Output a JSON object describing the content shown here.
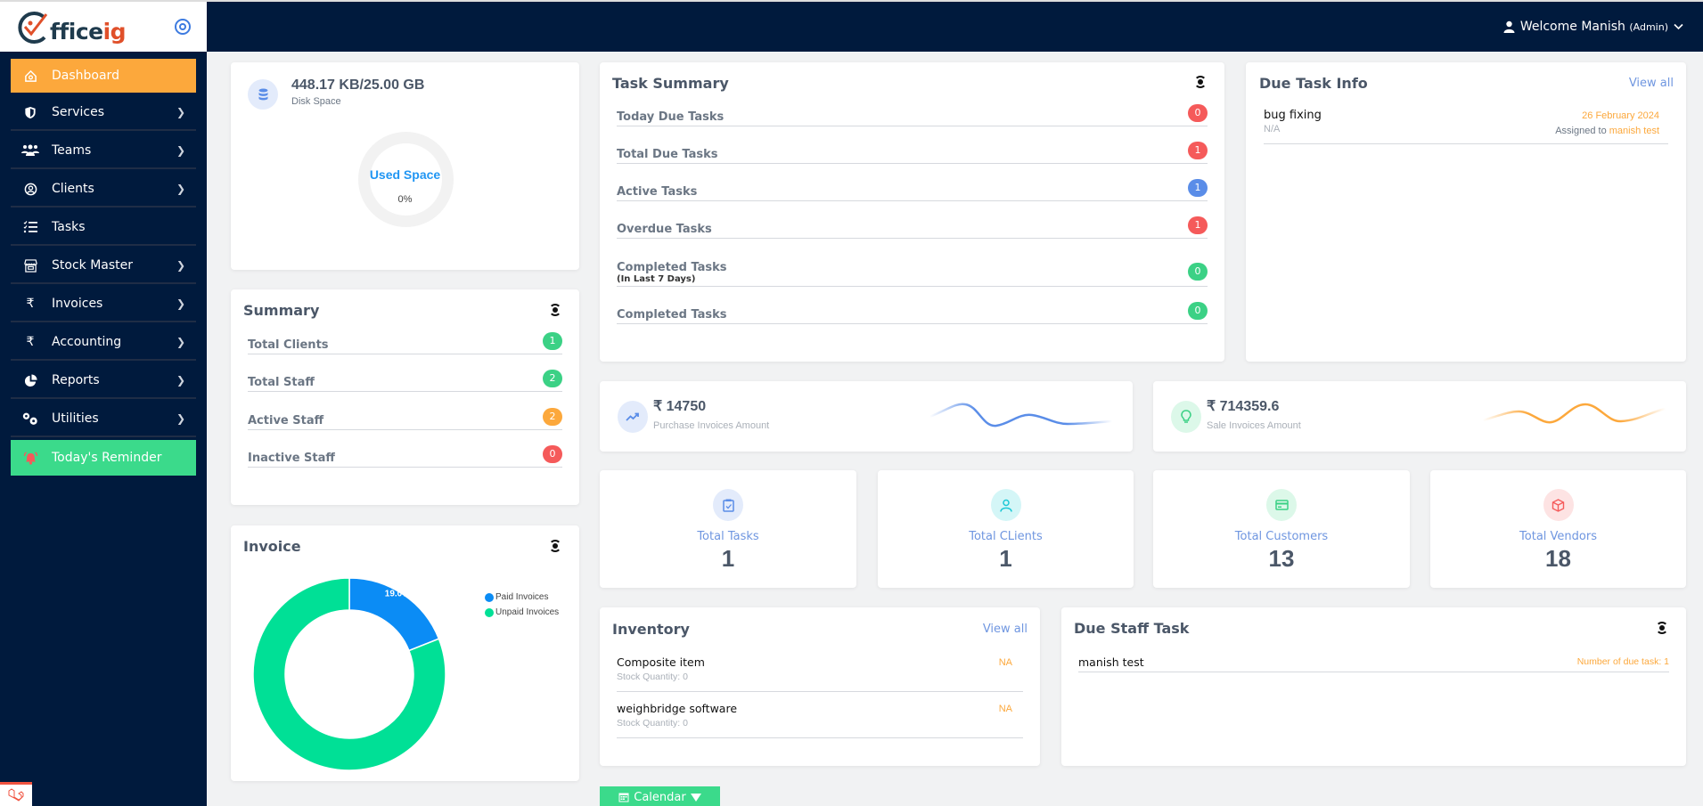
{
  "brand": {
    "logo_part1": "ffice",
    "logo_part2": "ig"
  },
  "sidebar": {
    "items": [
      {
        "label": "Dashboard",
        "icon": "home-icon",
        "active": true
      },
      {
        "label": "Services",
        "icon": "shield-icon"
      },
      {
        "label": "Teams",
        "icon": "users-icon"
      },
      {
        "label": "Clients",
        "icon": "user-circle-icon"
      },
      {
        "label": "Tasks",
        "icon": "tasklist-icon"
      },
      {
        "label": "Stock Master",
        "icon": "store-icon"
      },
      {
        "label": "Invoices",
        "icon": "rupee-icon"
      },
      {
        "label": "Accounting",
        "icon": "rupee-icon"
      },
      {
        "label": "Reports",
        "icon": "pie-chart-icon"
      },
      {
        "label": "Utilities",
        "icon": "gears-icon"
      },
      {
        "label": "Today's Reminder",
        "icon": "bell-icon"
      }
    ]
  },
  "header": {
    "welcome": "Welcome Manish",
    "role": "(Admin)"
  },
  "disk": {
    "value": "448.17 KB/25.00 GB",
    "label": "Disk Space",
    "used_label": "Used Space",
    "used_percent": "0%"
  },
  "summary": {
    "title": "Summary",
    "rows": [
      {
        "label": "Total Clients",
        "count": "1",
        "color": "#3bd185"
      },
      {
        "label": "Total Staff",
        "count": "2",
        "color": "#3bd185"
      },
      {
        "label": "Active Staff",
        "count": "2",
        "color": "#fca83c"
      },
      {
        "label": "Inactive Staff",
        "count": "0",
        "color": "#f55a5a"
      }
    ]
  },
  "task_summary": {
    "title": "Task Summary",
    "rows": [
      {
        "label": "Today Due Tasks",
        "sub": "",
        "count": "0",
        "color": "#f55a5a"
      },
      {
        "label": "Total Due Tasks",
        "sub": "",
        "count": "1",
        "color": "#f55a5a"
      },
      {
        "label": "Active Tasks",
        "sub": "",
        "count": "1",
        "color": "#5a8de8"
      },
      {
        "label": "Overdue Tasks",
        "sub": "",
        "count": "1",
        "color": "#f55a5a"
      },
      {
        "label": "Completed Tasks",
        "sub": "(In Last 7 Days)",
        "count": "0",
        "color": "#3bd185"
      },
      {
        "label": "Completed Tasks",
        "sub": "",
        "count": "0",
        "color": "#3bd185"
      }
    ]
  },
  "due_task_info": {
    "title": "Due Task Info",
    "view_all": "View all",
    "items": [
      {
        "name": "bug fixing",
        "desc": "N/A",
        "date": "26 February 2024",
        "assigned_prefix": "Assigned to",
        "assignee": "manish test"
      }
    ]
  },
  "purchase": {
    "amount": "₹ 14750",
    "label": "Purchase Invoices Amount"
  },
  "sale": {
    "amount": "₹ 714359.6",
    "label": "Sale Invoices Amount"
  },
  "stats": [
    {
      "label": "Total Tasks",
      "value": "1",
      "icon": "clipboard-check-icon",
      "bg": "#e3ebfb",
      "fg": "#5a8de8"
    },
    {
      "label": "Total CLients",
      "value": "1",
      "icon": "user-icon",
      "bg": "#d4f6f7",
      "fg": "#1cc8d6"
    },
    {
      "label": "Total Customers",
      "value": "13",
      "icon": "credit-card-icon",
      "bg": "#dcf8e9",
      "fg": "#3bd185"
    },
    {
      "label": "Total Vendors",
      "value": "18",
      "icon": "box-icon",
      "bg": "#fde3e3",
      "fg": "#f55a5a"
    }
  ],
  "invoice": {
    "title": "Invoice",
    "legend": [
      {
        "label": "Paid Invoices",
        "color": "#0b8cf5"
      },
      {
        "label": "Unpaid Invoices",
        "color": "#00e096"
      }
    ]
  },
  "chart_data": {
    "type": "pie",
    "title": "Invoice",
    "categories": [
      "Paid Invoices",
      "Unpaid Invoices"
    ],
    "values": [
      19.0,
      81.0
    ],
    "labels": [
      "19.0%",
      "81.0%"
    ],
    "legend": "top-right",
    "donut": true
  },
  "inventory": {
    "title": "Inventory",
    "view_all": "View all",
    "items": [
      {
        "name": "Composite item",
        "qty": "Stock Quantity: 0",
        "status": "NA"
      },
      {
        "name": "weighbridge software",
        "qty": "Stock Quantity: 0",
        "status": "NA"
      }
    ]
  },
  "due_staff": {
    "title": "Due Staff Task",
    "items": [
      {
        "name": "manish test",
        "count": "Number of due task: 1"
      }
    ]
  },
  "calendar": {
    "label": "Calendar"
  }
}
